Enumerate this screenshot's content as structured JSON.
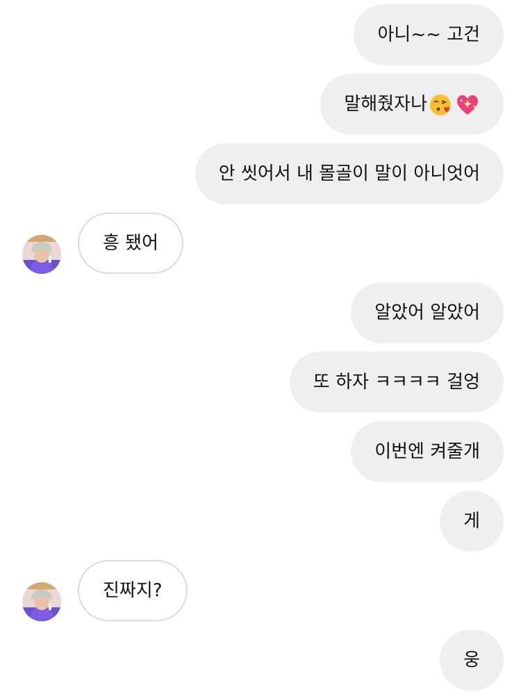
{
  "messages": [
    {
      "side": "sent",
      "text": "아니~~ 고건"
    },
    {
      "side": "sent",
      "text": "말해줬자나",
      "emoji": [
        "kissing-heart-emoji",
        "sparkling-heart-emoji"
      ]
    },
    {
      "side": "sent",
      "text": "안 씻어서 내 몰골이 말이 아니엇어"
    },
    {
      "side": "received",
      "text": "흥 됐어"
    },
    {
      "side": "sent",
      "text": "알았어 알았어"
    },
    {
      "side": "sent",
      "text": "또 하자 ㅋㅋㅋㅋ 걸엉"
    },
    {
      "side": "sent",
      "text": "이번엔 켜줄개"
    },
    {
      "side": "sent",
      "text": "게"
    },
    {
      "side": "received",
      "text": "진짜지?"
    },
    {
      "side": "sent",
      "text": "웅"
    }
  ],
  "colors": {
    "sent_bubble": "#efefef",
    "received_border": "#dbdbdb",
    "text": "#111111"
  }
}
